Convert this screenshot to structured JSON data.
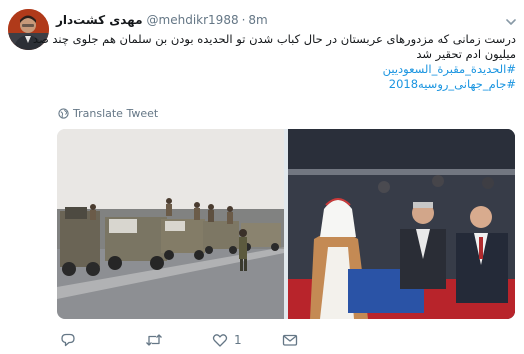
{
  "tweet": {
    "display_name": "مهدی کشت‌دار",
    "handle": "@mehdikr1988",
    "separator": "·",
    "time": "8m",
    "text_lines": [
      "درست زمانی که مزدورهای عربستان در حال کباب شدن تو الحدیده بودن بن سلمان هم جلوی چند صد",
      "میلیون ادم تحقیر شد"
    ],
    "hashtags": [
      "#الحديدة_مقبرة_السعوديين",
      "#جام_جهانی_روسیه2018"
    ],
    "translate_label": "Translate Tweet",
    "actions": {
      "reply_count": "",
      "retweet_count": "",
      "like_count": "1",
      "dm_count": ""
    }
  },
  "colors": {
    "link": "#1b95e0",
    "muted": "#657786",
    "text": "#14171a"
  },
  "icons": [
    "avatar",
    "chevron-down-icon",
    "globe-icon",
    "reply-icon",
    "retweet-icon",
    "like-icon",
    "message-icon"
  ]
}
